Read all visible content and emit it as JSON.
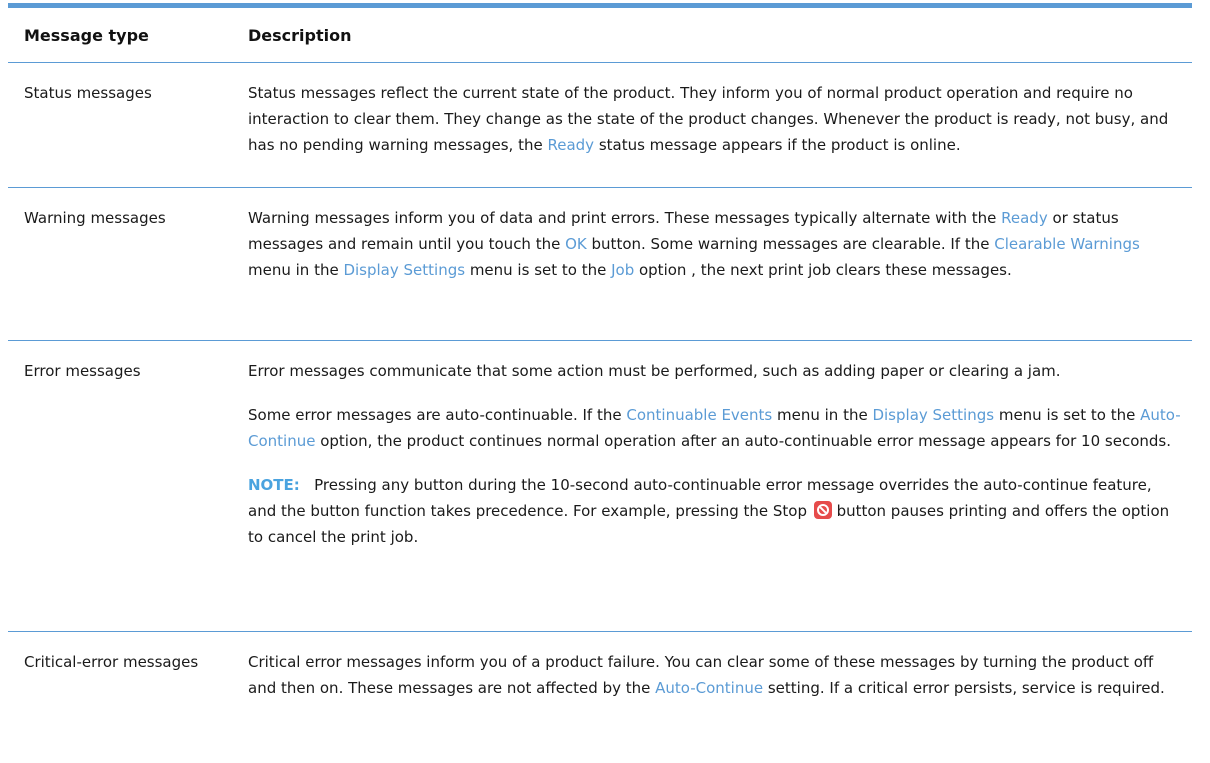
{
  "table": {
    "header": {
      "col1": "Message type",
      "col2": "Description"
    },
    "rows": [
      {
        "type": "Status messages",
        "desc": [
          [
            "Status messages reflect the current state of the product. They inform you of normal product operation and require no interaction to clear them. They change as the state of the product changes. Whenever the product is ready, not busy, and has no pending warning messages, the "
          ],
          [
            "Ready"
          ],
          [
            " status message appears if the product is online."
          ]
        ]
      },
      {
        "type": "Warning messages",
        "desc": [
          "Warning messages inform you of data and print errors. These messages typically alternate with the ",
          "Ready",
          " or status messages and remain until you touch the ",
          "OK",
          " button. Some warning messages are clearable. If the ",
          "Clearable Warnings",
          " menu in the ",
          "Display Settings",
          " menu is set to the ",
          "Job",
          " option , the next print job clears these messages."
        ]
      },
      {
        "type": "Error messages",
        "para1": "Error messages communicate that some action must be performed, such as adding paper or clearing a jam.",
        "para2": [
          "Some error messages are auto-continuable. If the ",
          "Continuable Events",
          " menu in the ",
          "Display Settings",
          " menu is set to the ",
          "Auto-Continue",
          " option, the product continues normal operation after an auto-continuable error message appears for 10 seconds."
        ],
        "note_label": "NOTE:",
        "note_text": "Pressing any button during the 10-second auto-continuable error message overrides the auto-continue feature, and the button function takes precedence. For example, pressing the Stop",
        "note_tail": "button pauses printing and offers the option to cancel the print job."
      },
      {
        "type": "Critical-error messages",
        "desc": [
          "Critical error messages inform you of a product failure. You can clear some of these messages by turning the product off and then on. These messages are not affected by the ",
          "Auto-Continue",
          " setting. If a critical error persists, service is required."
        ]
      }
    ]
  },
  "icons": {
    "stop": "stop-icon"
  },
  "colors": {
    "accent": "#5b9bd5",
    "stop": "#e64b4b"
  }
}
